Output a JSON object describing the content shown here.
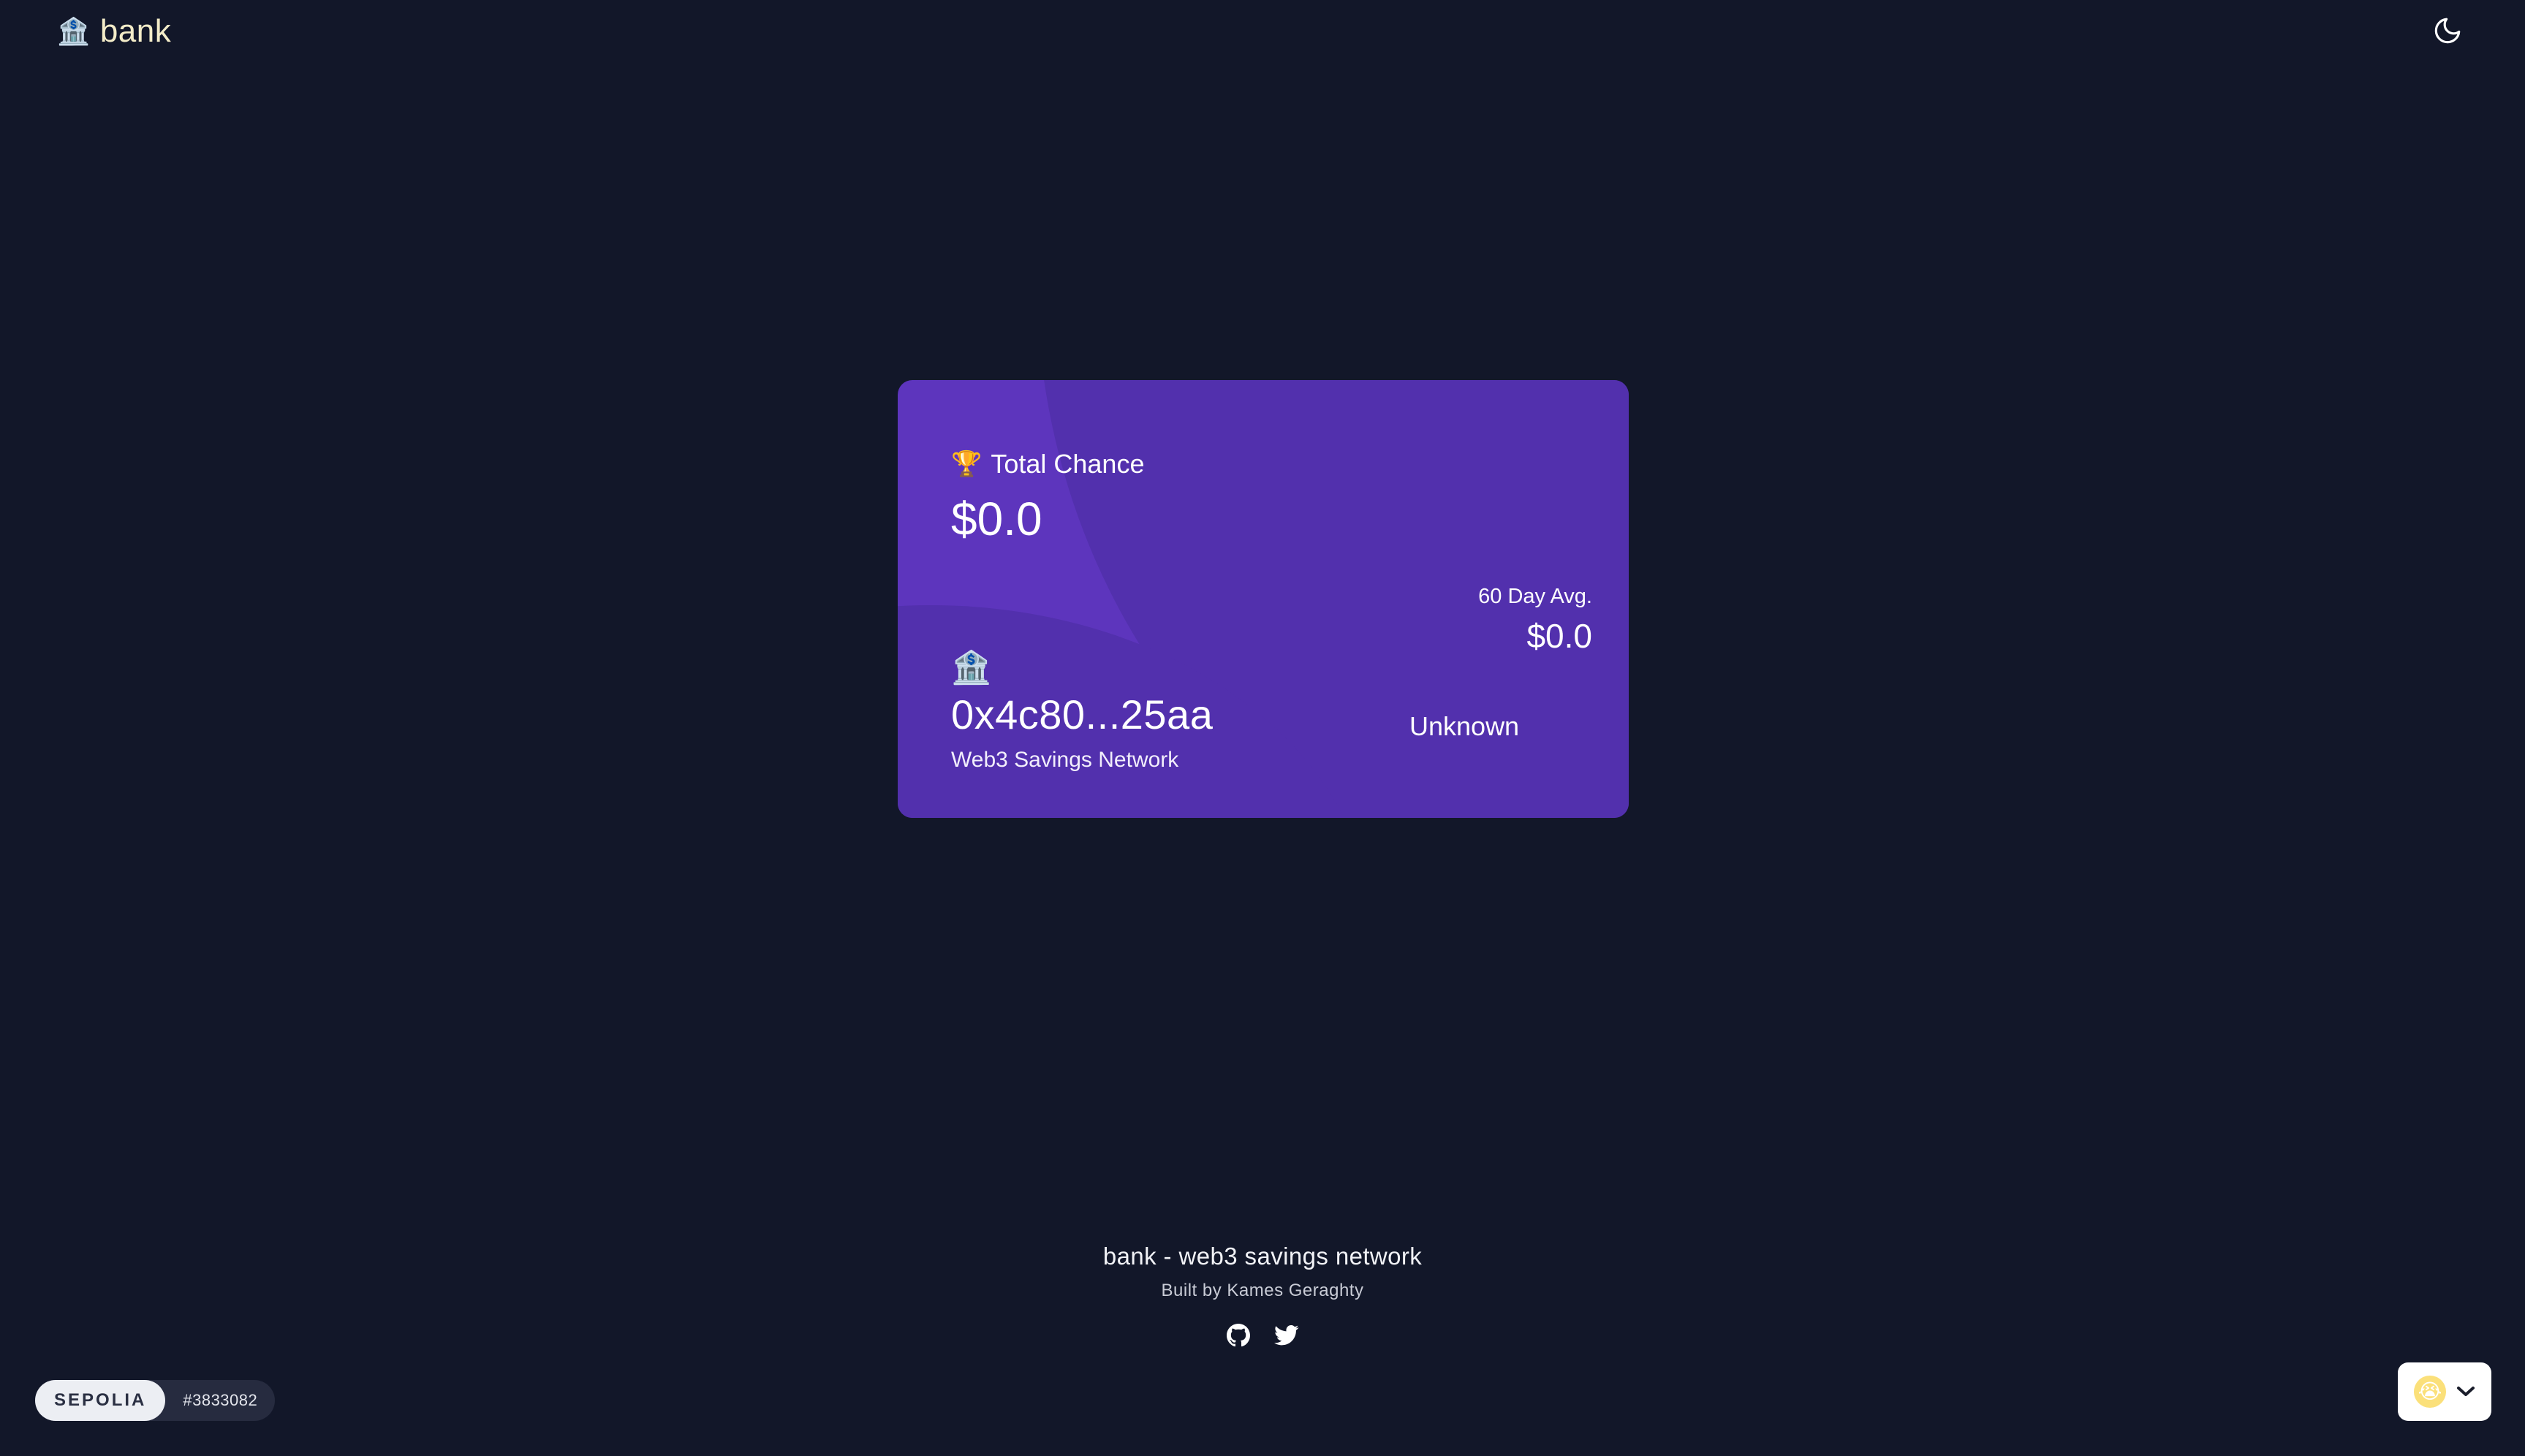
{
  "header": {
    "logo_emoji": "🏦",
    "logo_text": "bank",
    "theme_icon": "moon-icon"
  },
  "card": {
    "total_label_emoji": "🏆",
    "total_label": "Total Chance",
    "total_value": "$0.0",
    "avg_label": "60 Day Avg.",
    "avg_value": "$0.0",
    "bank_emoji": "🏦",
    "address": "0x4c80...25aa",
    "network_name": "Web3 Savings Network",
    "status": "Unknown",
    "colors": {
      "background": "#5d35bd",
      "accent_shape": "#5230ad"
    }
  },
  "footer": {
    "title": "bank - web3 savings network",
    "subtitle": "Built by Kames Geraghty",
    "links": [
      {
        "icon": "github-icon"
      },
      {
        "icon": "twitter-icon"
      }
    ]
  },
  "network_badge": {
    "chain": "SEPOLIA",
    "block": "#3833082"
  },
  "account": {
    "avatar_emoji": "😭",
    "chevron_icon": "chevron-down-icon"
  },
  "colors": {
    "page_background": "#121729",
    "logo_text": "#f3ecc8"
  }
}
